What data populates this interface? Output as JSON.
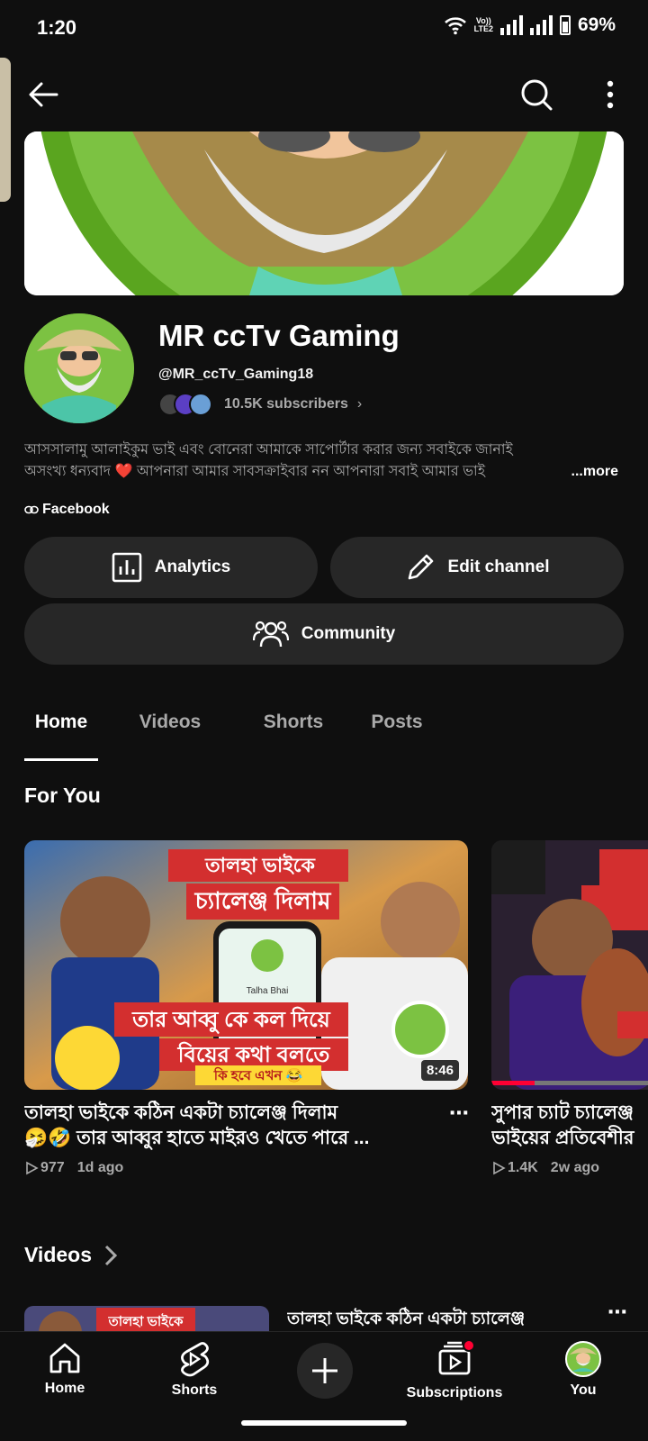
{
  "status": {
    "time": "1:20",
    "volte_top": "Vo))",
    "volte_bottom": "LTE2",
    "battery": "69%"
  },
  "topbar": {
    "back_icon": "arrow-left-icon",
    "search_icon": "search-icon",
    "more_icon": "more-vertical-icon"
  },
  "channel": {
    "name": "MR ccTv Gaming",
    "handle": "@MR_ccTv_Gaming18",
    "subscribers": "10.5K subscribers",
    "description_line1": "আসসালামু আলাইকুম ভাই এবং বোনেরা আমাকে সাপোর্টার করার জন্য সবাইকে জানাই",
    "description_line2": "অসংখ্য ধন্যবাদ ❤️ আপনারা আমার সাবসক্রাইবার নন আপনারা সবাই আমার ভাই",
    "more_label": "...more",
    "link_label": "Facebook"
  },
  "buttons": {
    "analytics": "Analytics",
    "edit_channel": "Edit channel",
    "community": "Community"
  },
  "tabs": [
    {
      "label": "Home",
      "active": true
    },
    {
      "label": "Videos",
      "active": false
    },
    {
      "label": "Shorts",
      "active": false
    },
    {
      "label": "Posts",
      "active": false
    }
  ],
  "sections": {
    "for_you": "For You",
    "videos": "Videos"
  },
  "for_you_videos": [
    {
      "title_line1": "তালহা ভাইকে কঠিন একটা চ্যালেঞ্জ দিলাম",
      "title_line2": "🤧🤣 তার আব্বুর হাতে মাইরও খেতে পারে ...",
      "views": "977",
      "age": "1d ago",
      "duration": "8:46",
      "thumb_top_text": "তালহা ভাইকে",
      "thumb_top_text2": "চ্যালেঞ্জ দিলাম",
      "thumb_bottom_text": "তার আব্বু কে কল দিয়ে",
      "thumb_bottom_text2": "বিয়ের কথা বলতে",
      "thumb_caption": "কি হবে এখন 😂",
      "thumb_phone_name": "Talha Bhai"
    },
    {
      "title_line1": "সুপার চ্যাট চ্যালেঞ্জ",
      "title_line2": "ভাইয়ের প্রতিবেশীর",
      "views": "1.4K",
      "age": "2w ago"
    }
  ],
  "videos_row": {
    "title": "তালহা ভাইকে কঠিন একটা চ্যালেঞ্জ",
    "thumb_text": "তালহা ভাইকে"
  },
  "bottom_nav": [
    {
      "label": "Home",
      "icon": "home-icon"
    },
    {
      "label": "Shorts",
      "icon": "shorts-icon"
    },
    {
      "label": "Subscriptions",
      "icon": "subscriptions-icon"
    },
    {
      "label": "You",
      "icon": "avatar"
    }
  ],
  "colors": {
    "background": "#0f0f0f",
    "pill": "#272727",
    "accent_red": "#ff0033",
    "secondary_text": "#aaaaaa"
  }
}
